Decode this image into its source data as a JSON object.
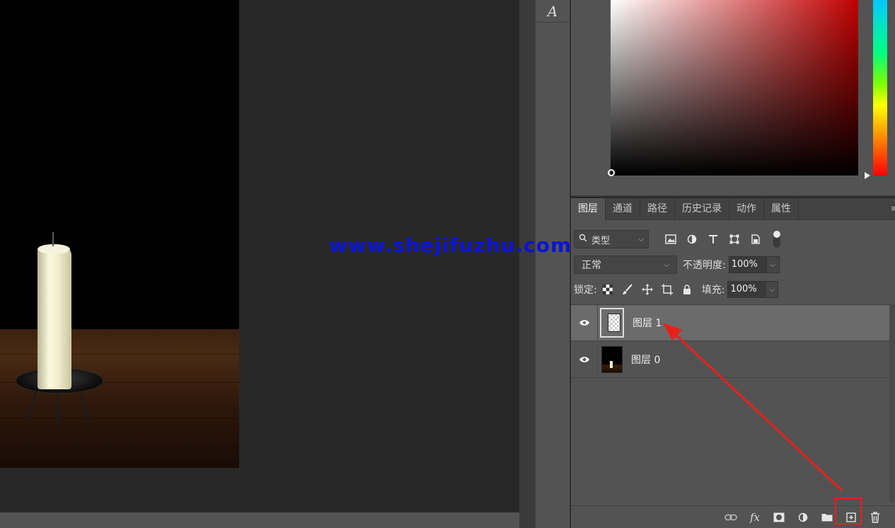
{
  "canvas": {
    "watermark": "www.shejifuzhu.com"
  },
  "tool_strip": {
    "character_tool_glyph": "A"
  },
  "color_panel": {
    "field_color": "#c00000"
  },
  "layers_panel": {
    "tabs": [
      {
        "label": "图层",
        "active": true
      },
      {
        "label": "通道",
        "active": false
      },
      {
        "label": "路径",
        "active": false
      },
      {
        "label": "历史记录",
        "active": false
      },
      {
        "label": "动作",
        "active": false
      },
      {
        "label": "属性",
        "active": false
      }
    ],
    "filter": {
      "selected": "类型",
      "icons": [
        "image-filter-icon",
        "adjustment-filter-icon",
        "type-filter-icon",
        "shape-filter-icon",
        "smart-object-filter-icon"
      ]
    },
    "blend_mode": "正常",
    "opacity_label": "不透明度:",
    "opacity_value": "100%",
    "lock_label": "锁定:",
    "lock_icons": [
      "lock-transparent-icon",
      "lock-paint-icon",
      "lock-position-icon",
      "lock-artboard-icon",
      "lock-all-icon"
    ],
    "fill_label": "填充:",
    "fill_value": "100%",
    "layers": [
      {
        "name": "图层 1",
        "selected": true,
        "visible": true,
        "thumbnail": "transparent"
      },
      {
        "name": "图层 0",
        "selected": false,
        "visible": true,
        "thumbnail": "photo"
      }
    ],
    "bottom_icons": [
      "link-layers-icon",
      "fx-icon",
      "add-mask-icon",
      "adjustment-layer-icon",
      "new-group-icon",
      "new-layer-icon",
      "delete-layer-icon"
    ],
    "fx_label": "fx"
  },
  "annotation": {
    "highlight_color": "#e8201b"
  }
}
